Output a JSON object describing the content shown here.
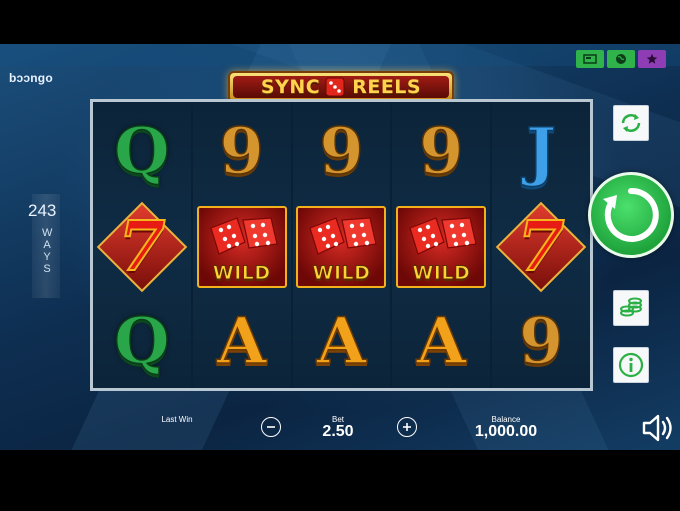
{
  "brand": "bɔɔngo",
  "logo": {
    "left": "SYNC",
    "right": "REELS"
  },
  "top_buttons": [
    {
      "name": "menu-card-icon",
      "color": "#2fb34a"
    },
    {
      "name": "globe-icon",
      "color": "#2fb34a"
    },
    {
      "name": "star-icon",
      "color": "#8e3db4"
    }
  ],
  "ways": {
    "number": "243",
    "word": "WAYS"
  },
  "reels": [
    [
      "Q",
      "7",
      "Q"
    ],
    [
      "9",
      "WILD",
      "A"
    ],
    [
      "9",
      "WILD",
      "A"
    ],
    [
      "9",
      "WILD",
      "A"
    ],
    [
      "J",
      "7",
      "9"
    ]
  ],
  "wild_label": "WILD",
  "bottom": {
    "last_win_label": "Last Win",
    "bet_label": "Bet",
    "bet_value": "2.50",
    "balance_label": "Balance",
    "balance_value": "1,000.00"
  },
  "colors": {
    "spin_green": "#1fa43c",
    "frame": "#b9c7d3",
    "background": "#0e2f52"
  }
}
